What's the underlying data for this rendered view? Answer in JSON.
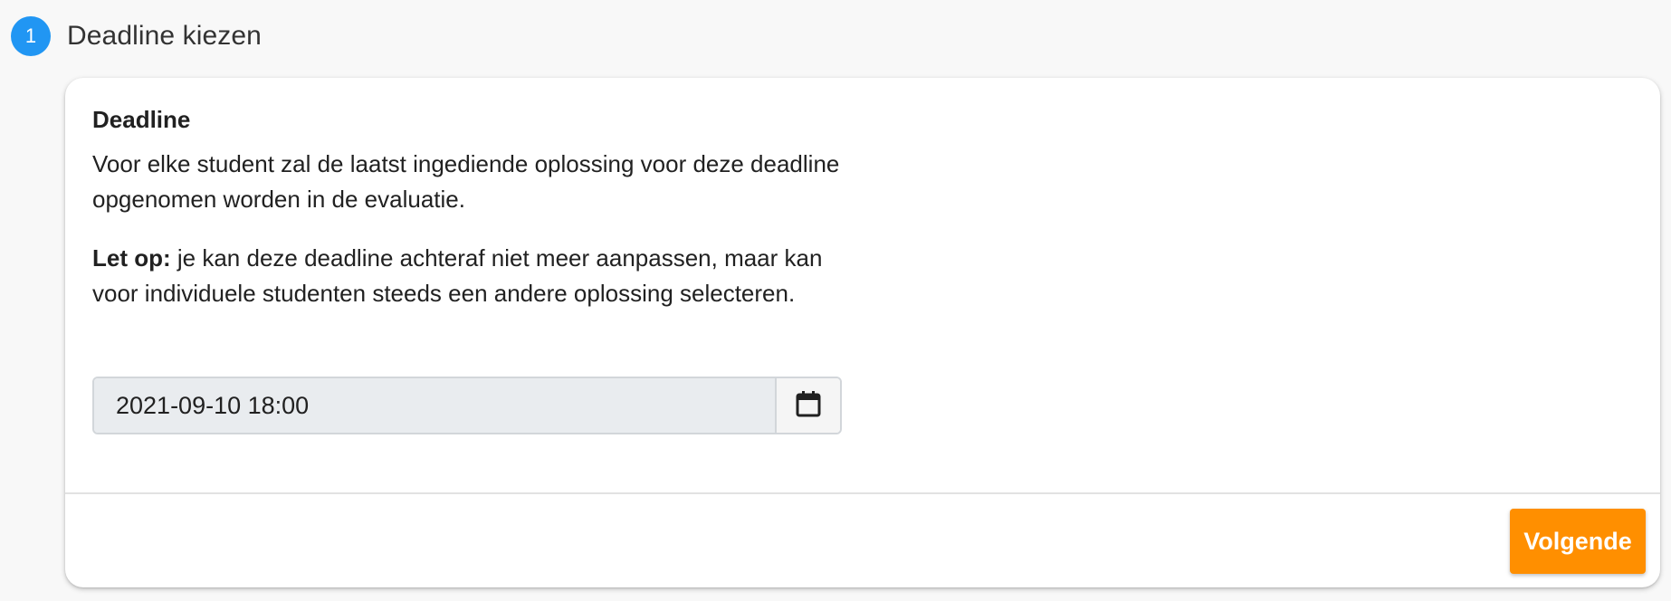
{
  "step": {
    "number": "1",
    "title": "Deadline kiezen"
  },
  "card": {
    "field_title": "Deadline",
    "description": "Voor elke student zal de laatst ingediende oplossing voor deze deadline opgenomen worden in de evaluatie.",
    "warning_label": "Let op:",
    "warning_text": " je kan deze deadline achteraf niet meer aanpassen, maar kan voor individuele studenten steeds een andere oplossing selecteren.",
    "date_value": "2021-09-10 18:00",
    "calendar_icon": "calendar-icon"
  },
  "actions": {
    "next_label": "Volgende"
  },
  "colors": {
    "step_badge": "#2196f3",
    "next_button": "#ff8f00",
    "input_background": "#e9ecef"
  }
}
